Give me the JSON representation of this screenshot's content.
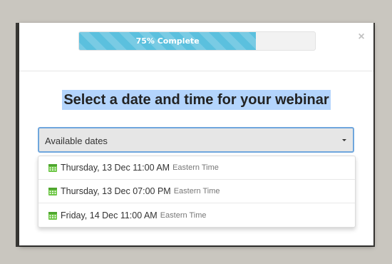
{
  "progress": {
    "label": "75% Complete",
    "percent": 75
  },
  "close": {
    "glyph": "×",
    "icon": "close-icon"
  },
  "title": "Select a date and time for your webinar",
  "select": {
    "value": "Available dates"
  },
  "options": [
    {
      "text": "Thursday, 13 Dec 11:00 AM",
      "tz": "Eastern Time"
    },
    {
      "text": "Thursday, 13 Dec 07:00 PM",
      "tz": "Eastern Time"
    },
    {
      "text": "Friday, 14 Dec 11:00 AM",
      "tz": "Eastern Time"
    }
  ],
  "colors": {
    "progress_fill": "#5bc0de",
    "calendar_icon": "#6cc644",
    "selection_highlight": "#b3d4fc",
    "focus_border": "#6fa6dd"
  }
}
